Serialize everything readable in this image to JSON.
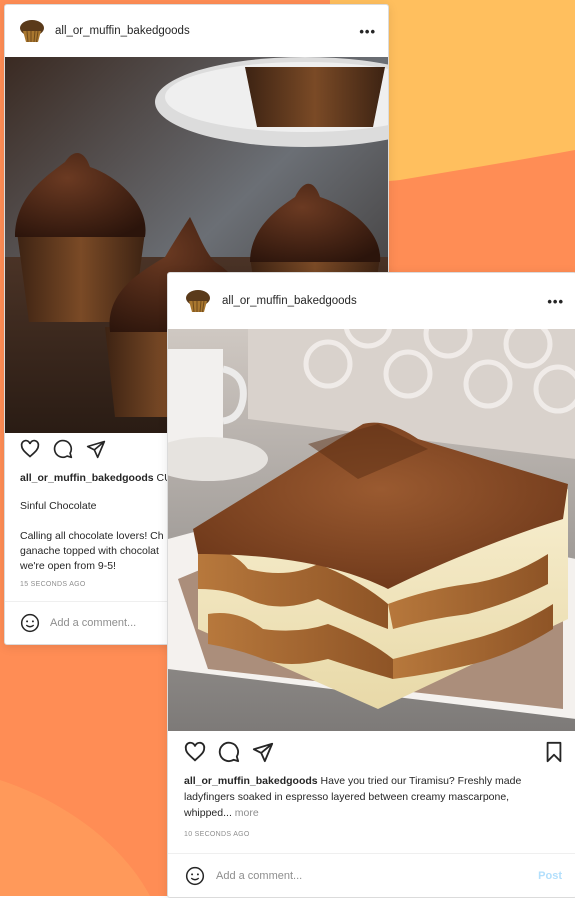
{
  "colors": {
    "bg_orange": "#ff8d55",
    "bg_yellow": "#ffbf5e",
    "card_border": "#dbdbdb",
    "text": "#262626",
    "muted": "#8e8e8e",
    "post_button": "#b2dffc"
  },
  "post1": {
    "username": "all_or_muffin_bakedgoods",
    "more_icon": "ellipsis-icon",
    "photo_subject": "chocolate cupcakes with chocolate ganache",
    "caption_user": "all_or_muffin_bakedgoods",
    "caption_text": "CU",
    "title": "Sinful Chocolate",
    "body_line1": "Calling all chocolate lovers! Ch",
    "body_line2": "ganache topped with chocolat",
    "body_line3": "we're open from 9-5!",
    "time": "15 SECONDS AGO",
    "comment_placeholder": "Add a comment..."
  },
  "post2": {
    "username": "all_or_muffin_bakedgoods",
    "more_icon": "ellipsis-icon",
    "photo_subject": "tiramisu slice dusted with cocoa",
    "caption_user": "all_or_muffin_bakedgoods",
    "caption_line1": "Have you tried our Tiramisu? Freshly made",
    "caption_line2": "ladyfingers soaked in espresso layered between creamy mascarpone,",
    "caption_line3": "whipped...",
    "more_link": "more",
    "time": "10 SECONDS AGO",
    "comment_placeholder": "Add a comment...",
    "post_label": "Post"
  }
}
